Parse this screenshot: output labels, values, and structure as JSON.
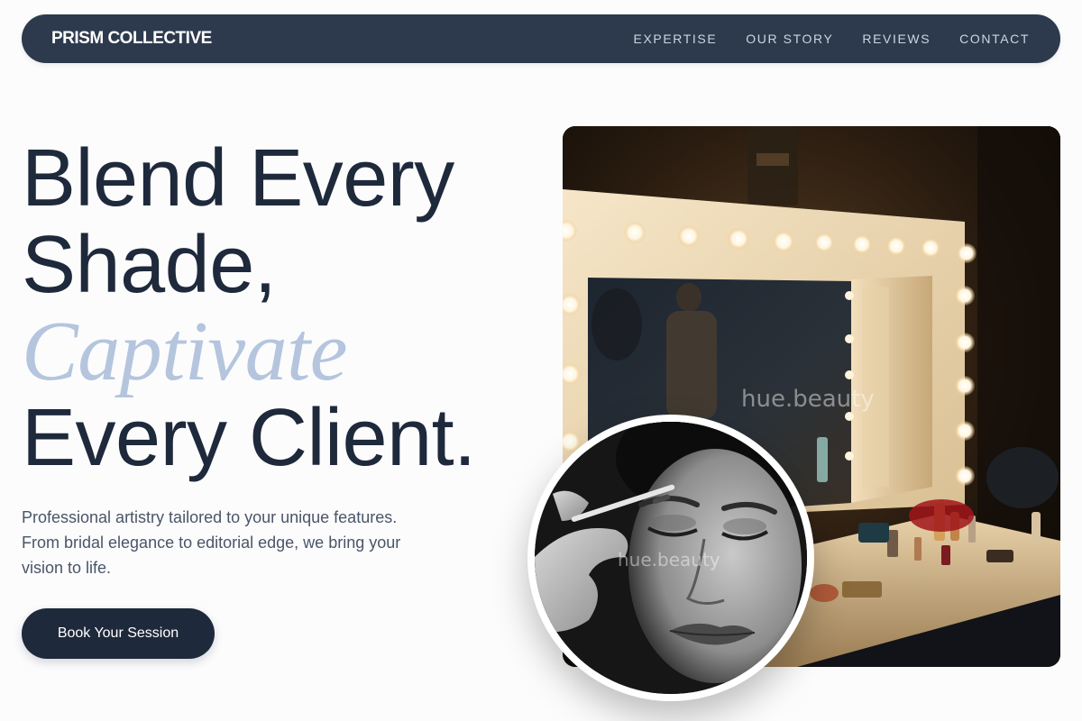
{
  "nav": {
    "brand": "PRISM COLLECTIVE",
    "links": [
      "EXPERTISE",
      "OUR STORY",
      "REVIEWS",
      "CONTACT"
    ]
  },
  "hero": {
    "title_line1": "Blend Every",
    "title_line2": "Shade,",
    "title_accent": "Captivate",
    "title_line4": "Every Client.",
    "description": "Professional artistry tailored to your unique features. From bridal elegance to editorial edge, we bring your vision to life.",
    "cta_label": "Book Your Session"
  },
  "images": {
    "main_watermark": "hue.beauty",
    "circle_watermark": "hue.beauty"
  },
  "colors": {
    "nav_bg": "#2d3a4e",
    "text_dark": "#1e293b",
    "accent": "#b4c5dd",
    "page_bg": "#fcfcfd"
  }
}
